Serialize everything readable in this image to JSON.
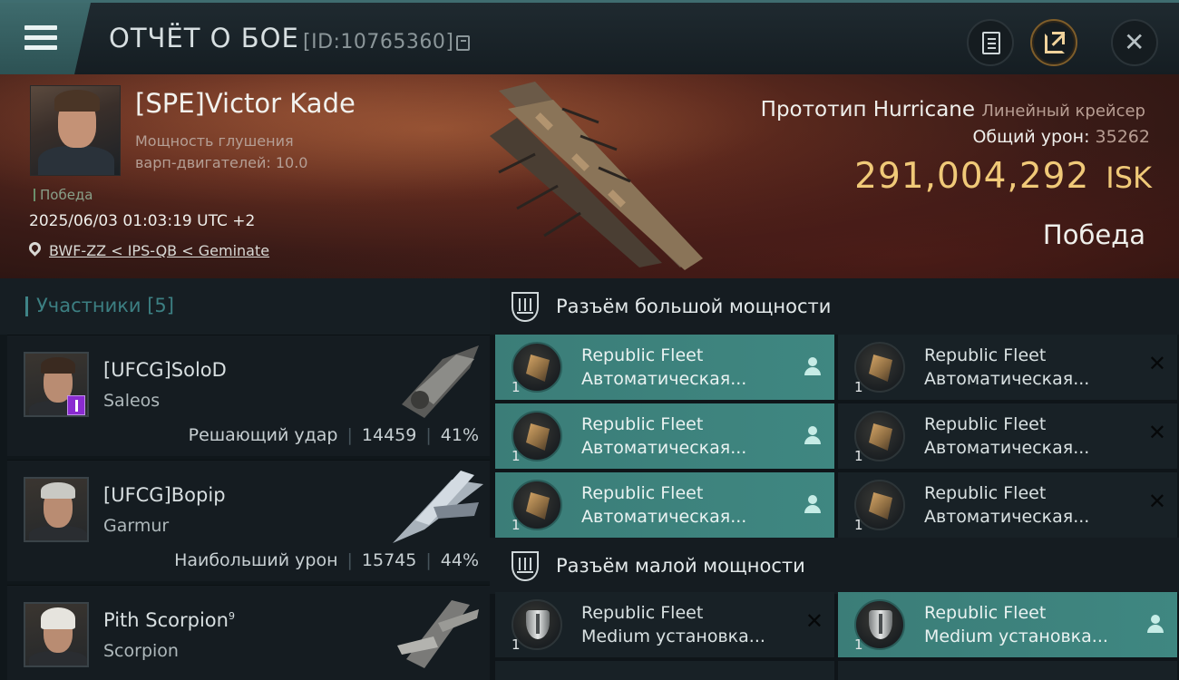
{
  "header": {
    "title": "ОТЧЁТ О БОЕ",
    "report_id": "[ID:10765360]",
    "buttons": [
      "menu-icon",
      "clipboard-icon",
      "share-icon",
      "close-icon"
    ]
  },
  "victim": {
    "pilot_name": "[SPE]Victor Kade",
    "attribute": "Мощность глушения варп-двигателей: 10.0",
    "status_tag": "Победа",
    "timestamp": "2025/06/03 01:03:19 UTC +2",
    "location": "BWF-ZZ < IPS-QB < Geminate",
    "ship_name": "Прототип Hurricane",
    "ship_class": "Линейный крейсер",
    "total_damage_label": "Общий урон:",
    "total_damage": "35262",
    "isk_value": "291,004,292",
    "isk_unit": "ISK",
    "result": "Победа"
  },
  "participants": {
    "title": "Участники [5]",
    "items": [
      {
        "name": "[UFCG]SoloD",
        "ship": "Saleos",
        "role": "Решающий удар",
        "damage": "14459",
        "percent": "41%",
        "badge": true
      },
      {
        "name": "[UFCG]Bopip",
        "ship": "Garmur",
        "role": "Наибольший урон",
        "damage": "15745",
        "percent": "44%",
        "badge": false
      },
      {
        "name": "Pith Scorpion",
        "sup": "9",
        "ship": "Scorpion",
        "role": "",
        "damage": "",
        "percent": "",
        "badge": false
      }
    ]
  },
  "fitting": {
    "high_title": "Разъём большой мощности",
    "low_title": "Разъём малой мощности",
    "high_slots": [
      {
        "line1": "Republic Fleet",
        "line2": "Автоматическая...",
        "qty": "1",
        "state": "active",
        "icon": "turret"
      },
      {
        "line1": "Republic Fleet",
        "line2": "Автоматическая...",
        "qty": "1",
        "state": "destroyed",
        "icon": "turret"
      },
      {
        "line1": "Republic Fleet",
        "line2": "Автоматическая...",
        "qty": "1",
        "state": "active",
        "icon": "turret"
      },
      {
        "line1": "Republic Fleet",
        "line2": "Автоматическая...",
        "qty": "1",
        "state": "destroyed",
        "icon": "turret"
      },
      {
        "line1": "Republic Fleet",
        "line2": "Автоматическая...",
        "qty": "1",
        "state": "active",
        "icon": "turret"
      },
      {
        "line1": "Republic Fleet",
        "line2": "Автоматическая...",
        "qty": "1",
        "state": "destroyed",
        "icon": "turret"
      }
    ],
    "low_slots": [
      {
        "line1": "Republic Fleet",
        "line2": "Medium установка...",
        "qty": "1",
        "state": "destroyed",
        "icon": "shield"
      },
      {
        "line1": "Republic Fleet",
        "line2": "Medium установка...",
        "qty": "1",
        "state": "active",
        "icon": "shield"
      }
    ]
  },
  "colors": {
    "accent_teal": "#3f8781",
    "isk_gold": "#f0c978",
    "banner_red": "#5d2a1e"
  }
}
